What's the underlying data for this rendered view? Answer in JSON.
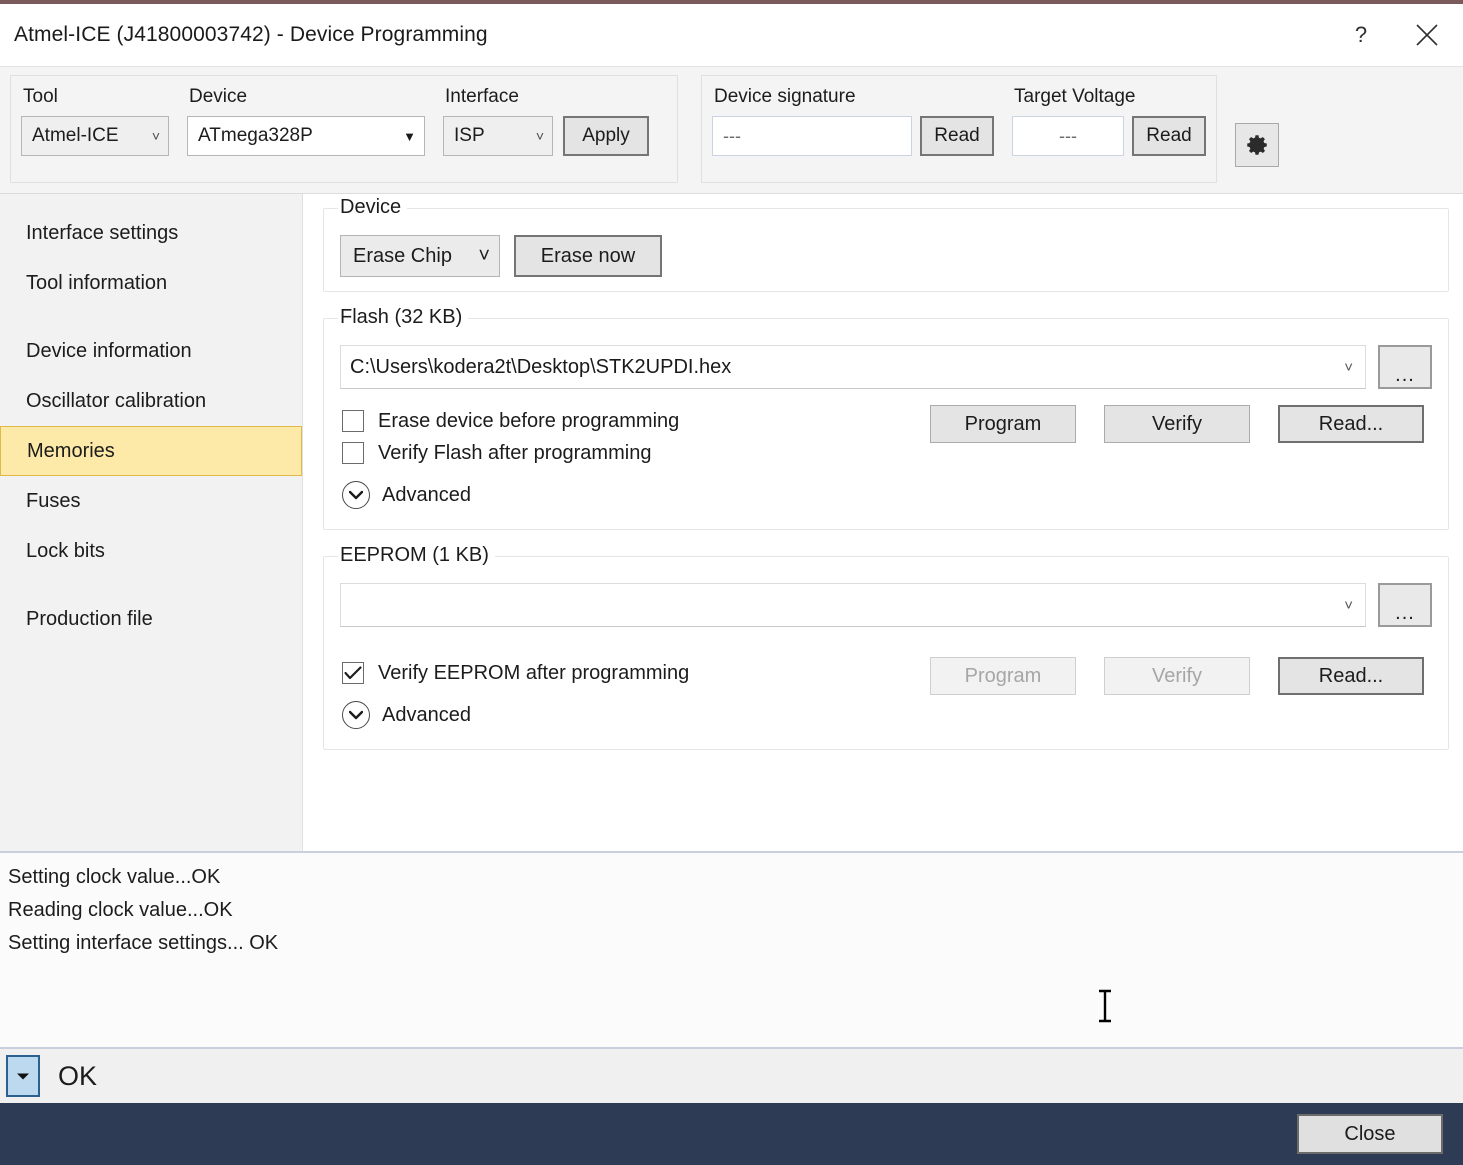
{
  "window": {
    "title": "Atmel-ICE (J41800003742) - Device Programming",
    "help_label": "?",
    "close_icon_name": "close-icon",
    "accent_border": "#7a5a5a",
    "footer_color": "#2e3b55",
    "selection_color": "#fdeaa8"
  },
  "toolbar": {
    "tool": {
      "label": "Tool",
      "value": "Atmel-ICE"
    },
    "device": {
      "label": "Device",
      "value": "ATmega328P"
    },
    "interface": {
      "label": "Interface",
      "value": "ISP"
    },
    "apply_label": "Apply",
    "device_signature": {
      "label": "Device signature",
      "value": "---",
      "read_label": "Read"
    },
    "target_voltage": {
      "label": "Target Voltage",
      "value": "---",
      "read_label": "Read"
    },
    "settings_icon": "gear-icon"
  },
  "sidebar": {
    "items": [
      {
        "label": "Interface settings",
        "selected": false,
        "gap": false
      },
      {
        "label": "Tool information",
        "selected": false,
        "gap": false
      },
      {
        "label": "Device information",
        "selected": false,
        "gap": true
      },
      {
        "label": "Oscillator calibration",
        "selected": false,
        "gap": false
      },
      {
        "label": "Memories",
        "selected": true,
        "gap": false
      },
      {
        "label": "Fuses",
        "selected": false,
        "gap": false
      },
      {
        "label": "Lock bits",
        "selected": false,
        "gap": false
      },
      {
        "label": "Production file",
        "selected": false,
        "gap": true
      }
    ]
  },
  "device_group": {
    "legend": "Device",
    "erase_mode": "Erase Chip",
    "erase_now_label": "Erase now"
  },
  "flash_group": {
    "legend": "Flash (32 KB)",
    "file_path": "C:\\Users\\kodera2t\\Desktop\\STK2UPDI.hex",
    "browse_label": "...",
    "checkbox_erase": {
      "label": "Erase device before programming",
      "checked": false
    },
    "checkbox_verify": {
      "label": "Verify Flash after programming",
      "checked": false
    },
    "advanced_label": "Advanced",
    "buttons": [
      {
        "label": "Program",
        "enabled": true,
        "emphasis": false
      },
      {
        "label": "Verify",
        "enabled": true,
        "emphasis": false
      },
      {
        "label": "Read...",
        "enabled": true,
        "emphasis": true
      }
    ]
  },
  "eeprom_group": {
    "legend": "EEPROM (1 KB)",
    "file_path": "",
    "browse_label": "...",
    "checkbox_verify": {
      "label": "Verify EEPROM after programming",
      "checked": true
    },
    "advanced_label": "Advanced",
    "buttons": [
      {
        "label": "Program",
        "enabled": false,
        "emphasis": false
      },
      {
        "label": "Verify",
        "enabled": false,
        "emphasis": false
      },
      {
        "label": "Read...",
        "enabled": true,
        "emphasis": true
      }
    ]
  },
  "log": {
    "lines": [
      "Setting clock value...OK",
      "Reading clock value...OK",
      "Setting interface settings... OK"
    ]
  },
  "statusbar": {
    "toggle_icon": "chevron-down-icon",
    "text": "OK"
  },
  "footer": {
    "close_label": "Close"
  }
}
